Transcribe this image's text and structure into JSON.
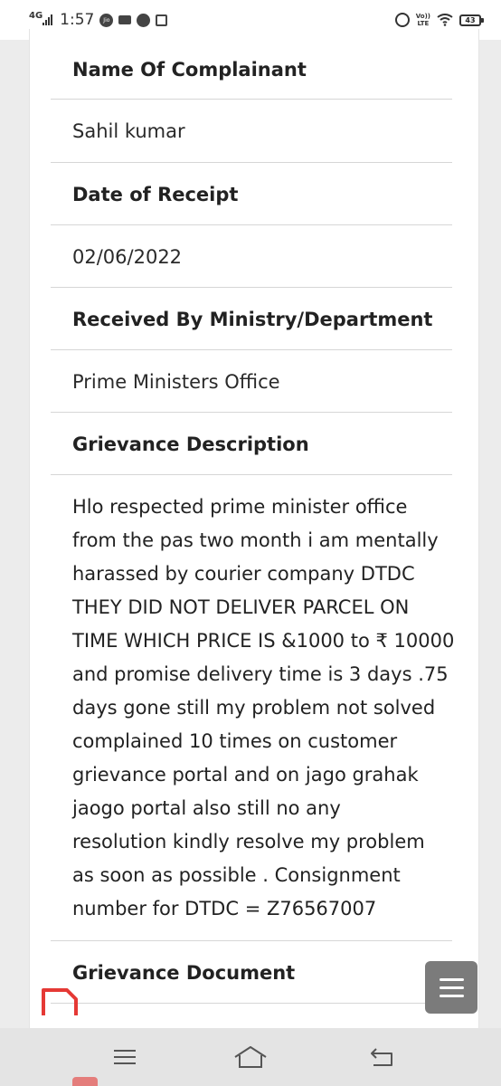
{
  "status_bar": {
    "network": "4G",
    "time": "1:57",
    "jio_label": "Jio",
    "volte_line1": "Vo))",
    "volte_line2": "LTE",
    "battery": "43"
  },
  "grievance": {
    "complainant_label": "Name Of Complainant",
    "complainant_value": "Sahil kumar",
    "receipt_label": "Date of Receipt",
    "receipt_value": "02/06/2022",
    "ministry_label": "Received By Ministry/Department",
    "ministry_value": "Prime Ministers Office",
    "description_label": "Grievance Description",
    "description_lines": [
      "Hlo respected prime minister office",
      "from the pas two month i am mentally",
      "harassed by courier company DTDC",
      "THEY DID NOT DELIVER PARCEL ON",
      "TIME WHICH PRICE IS &1000 to ₹ 10000",
      "and promise delivery time is 3 days .75",
      "days gone still my problem not solved",
      "complained 10 times on customer",
      "grievance portal and on jago grahak",
      "jaogo portal also still no any",
      "resolution kindly resolve my problem",
      "as soon as possible . Consignment",
      "number for DTDC = Z76567007"
    ],
    "document_label": "Grievance Document",
    "document_icon": "pdf-file-icon"
  },
  "fab": {
    "icon": "hamburger-menu-icon"
  },
  "nav": {
    "menu_icon": "menu-icon",
    "home_icon": "home-icon",
    "back_icon": "back-icon"
  }
}
